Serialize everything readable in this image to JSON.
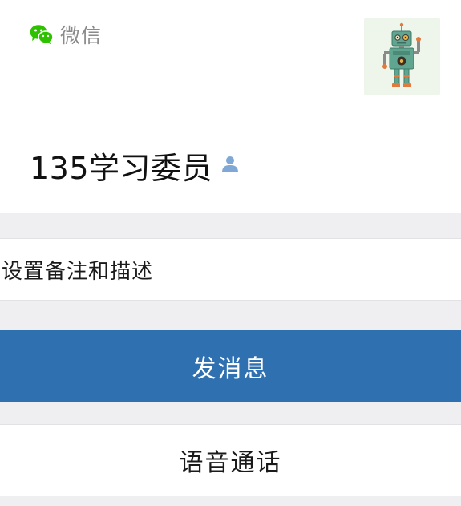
{
  "header": {
    "source_label": "微信",
    "source_icon": "wechat-icon"
  },
  "profile": {
    "name": "135学习委员",
    "badge_icon": "person-icon",
    "avatar": "robot-avatar"
  },
  "actions": {
    "remark_label": "设置备注和描述",
    "send_message_label": "发消息",
    "voice_call_label": "语音通话"
  },
  "colors": {
    "wechat_green": "#2dc100",
    "primary_button": "#2f70b0",
    "badge_blue": "#7fa8d6",
    "background": "#efeff2"
  }
}
